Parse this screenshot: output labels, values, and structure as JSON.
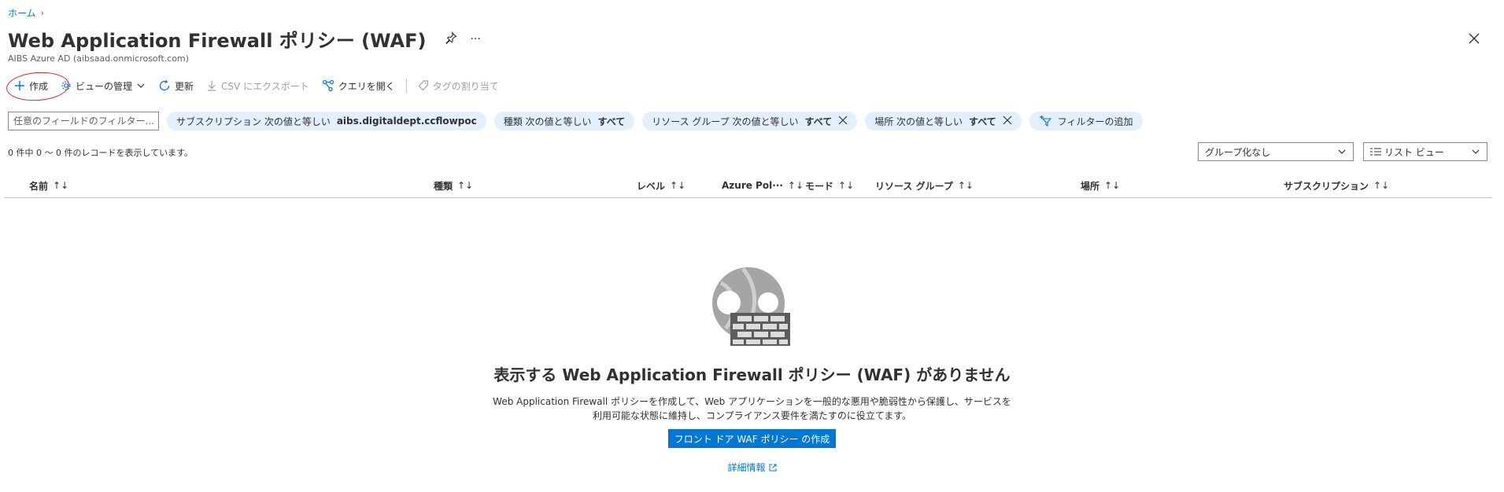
{
  "breadcrumb": {
    "home": "ホーム",
    "separator": "›"
  },
  "header": {
    "title": "Web Application Firewall ポリシー (WAF)",
    "subtitle": "AIBS Azure AD (aibsaad.onmicrosoft.com)",
    "more": "···"
  },
  "toolbar": {
    "create": "作成",
    "manage_view": "ビューの管理",
    "refresh": "更新",
    "export_csv": "CSV にエクスポート",
    "open_query": "クエリを開く",
    "assign_tags": "タグの割り当て"
  },
  "filters": {
    "placeholder": "任意のフィールドのフィルター...",
    "pills": [
      {
        "label": "サブスクリプション 次の値と等しい",
        "value": "aibs.digitaldept.ccflowpoc",
        "removable": false
      },
      {
        "label": "種類 次の値と等しい",
        "value": "すべて",
        "removable": false
      },
      {
        "label": "リソース グループ 次の値と等しい",
        "value": "すべて",
        "removable": true
      },
      {
        "label": "場所 次の値と等しい",
        "value": "すべて",
        "removable": true
      }
    ],
    "add_filter": "フィルターの追加"
  },
  "records": {
    "summary": "0 件中 0 ～ 0 件のレコードを表示しています。"
  },
  "grouping": {
    "selected": "グループ化なし"
  },
  "view": {
    "selected": "リスト ビュー"
  },
  "table": {
    "columns": [
      "名前",
      "種類",
      "レベル",
      "Azure Pol···",
      "モード",
      "リソース グループ",
      "場所",
      "サブスクリプション"
    ]
  },
  "empty_state": {
    "title": "表示する Web Application Firewall ポリシー (WAF) がありません",
    "description": "Web Application Firewall ポリシーを作成して、Web アプリケーションを一般的な悪用や脆弱性から保護し、サービスを利用可能な状態に維持し、コンプライアンス要件を満たすのに役立てます。",
    "primary_button": "フロント ドア WAF ポリシー の作成",
    "learn_more": "詳細情報"
  },
  "colors": {
    "accent": "#0078d4",
    "pill_bg": "#e1efff",
    "annotation": "#e02020"
  }
}
